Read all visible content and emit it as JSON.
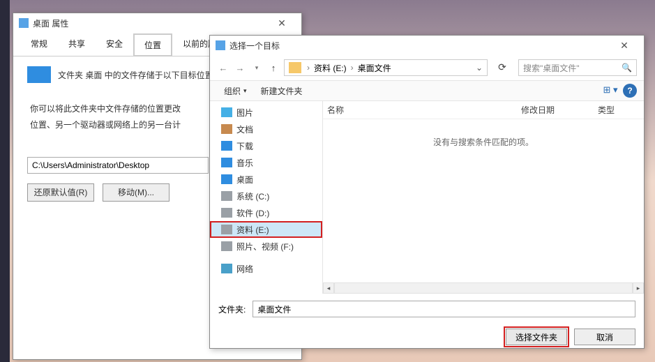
{
  "props": {
    "title": "桌面 属性",
    "tabs": {
      "general": "常规",
      "share": "共享",
      "security": "安全",
      "location": "位置",
      "previous": "以前的版本"
    },
    "intro": "文件夹 桌面 中的文件存储于以下目标位置",
    "desc": "你可以将此文件夹中文件存储的位置更改\n位置、另一个驱动器或网络上的另一台计",
    "path": "C:\\Users\\Administrator\\Desktop",
    "restore": "还原默认值(R)",
    "move": "移动(M)..."
  },
  "picker": {
    "title": "选择一个目标",
    "crumb": {
      "segment1": "资料 (E:)",
      "segment2": "桌面文件"
    },
    "search_placeholder": "搜索\"桌面文件\"",
    "toolbar": {
      "organize": "组织",
      "newfolder": "新建文件夹"
    },
    "cols": {
      "name": "名称",
      "mdate": "修改日期",
      "type": "类型"
    },
    "empty": "没有与搜索条件匹配的项。",
    "tree": {
      "pictures": "图片",
      "documents": "文档",
      "downloads": "下载",
      "music": "音乐",
      "desktop": "桌面",
      "sysC": "系统 (C:)",
      "softD": "软件 (D:)",
      "dataE": "资料 (E:)",
      "photoF": "照片、视频 (F:)",
      "network": "网络"
    },
    "folder_label": "文件夹:",
    "folder_value": "桌面文件",
    "select": "选择文件夹",
    "cancel": "取消"
  }
}
